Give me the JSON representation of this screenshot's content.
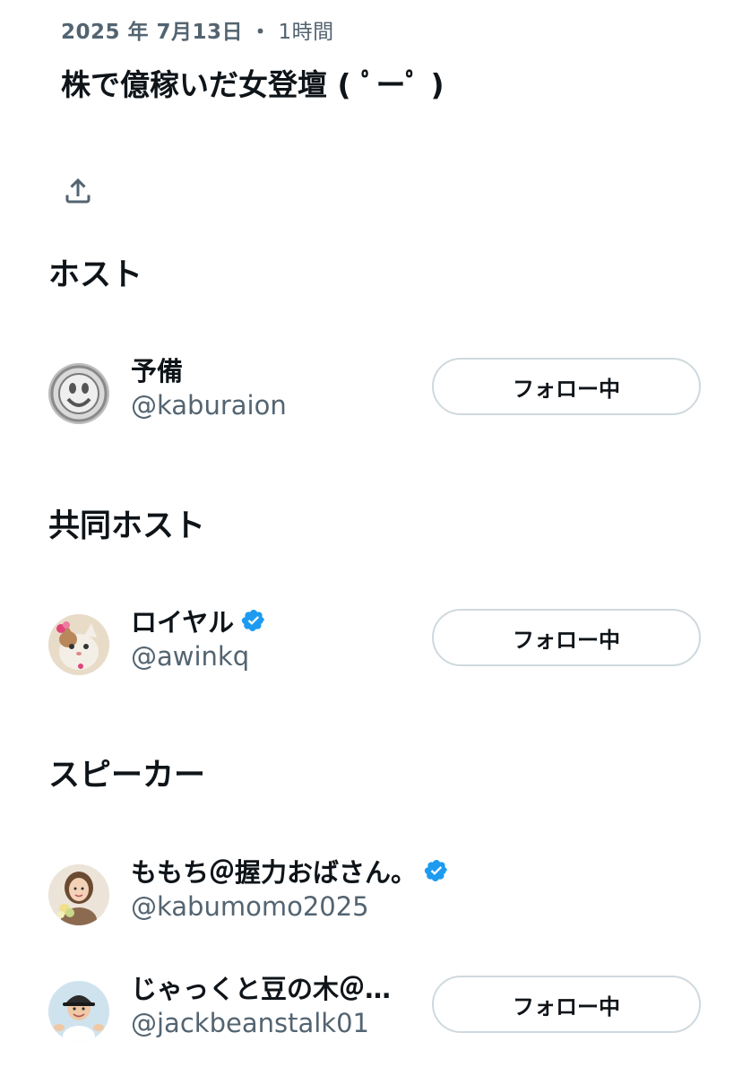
{
  "meta": {
    "date": "2025 年 7月13日",
    "separator": "・",
    "duration": "1時間"
  },
  "space": {
    "title": "株で億稼いだ女登壇 ( ﾟーﾟ )"
  },
  "icons": {
    "share": "share-upload-icon",
    "verified": "verified-badge-icon"
  },
  "colors": {
    "text_primary": "#0f1419",
    "text_secondary": "#536471",
    "button_border": "#cfd9de",
    "verified_blue": "#1d9bf0"
  },
  "sections": {
    "host": {
      "heading": "ホスト",
      "people": [
        {
          "name": "予備",
          "handle": "@kaburaion",
          "verified": false,
          "follow_label": "フォロー中"
        }
      ]
    },
    "cohost": {
      "heading": "共同ホスト",
      "people": [
        {
          "name": "ロイヤル",
          "handle": "@awinkq",
          "verified": true,
          "follow_label": "フォロー中"
        }
      ]
    },
    "speakers": {
      "heading": "スピーカー",
      "people": [
        {
          "name": "ももち＠握力おばさん。",
          "handle": "@kabumomo2025",
          "verified": true,
          "follow_label": ""
        },
        {
          "name": "じゃっくと豆の木＠…",
          "handle": "@jackbeanstalk01",
          "verified": false,
          "follow_label": "フォロー中"
        }
      ]
    }
  }
}
